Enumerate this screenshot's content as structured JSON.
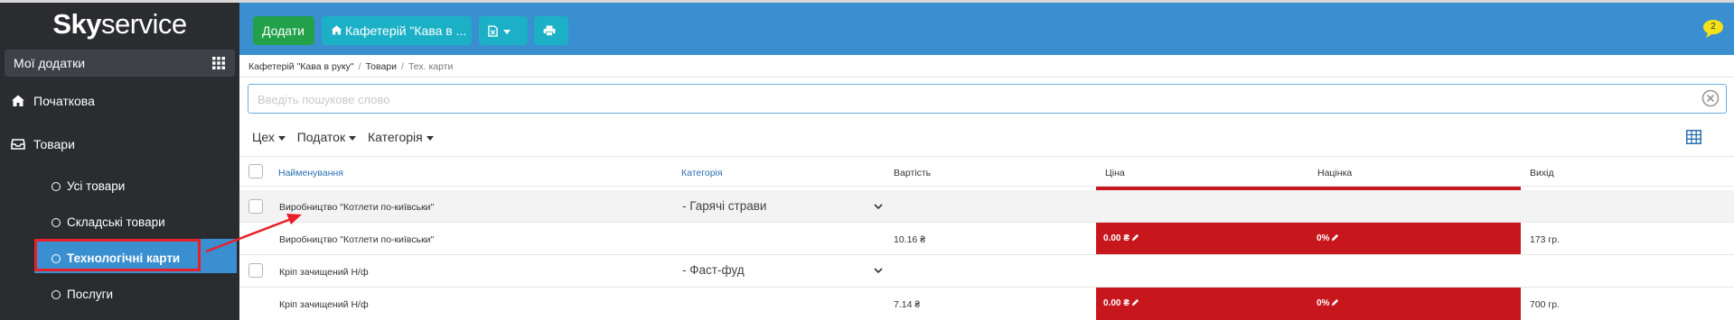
{
  "sidebar": {
    "logo_bold": "Sky",
    "logo_light": "service",
    "my_apps": "Мої додатки",
    "nav": [
      {
        "label": "Початкова",
        "icon": "home-icon"
      },
      {
        "label": "Товари",
        "icon": "inbox-icon"
      }
    ],
    "sub_items": [
      {
        "label": "Усі товари"
      },
      {
        "label": "Складські товари"
      },
      {
        "label": "Технологічні карти",
        "active": true
      },
      {
        "label": "Послуги"
      }
    ]
  },
  "toolbar": {
    "add_label": "Додати",
    "store_label": "Кафетерій \"Кава в ...",
    "notification_count": "2"
  },
  "breadcrumb": [
    "Кафетерій \"Кава в руку\"",
    "Товари",
    "Тех. карти"
  ],
  "search": {
    "placeholder": "Введіть пошукове слово",
    "value": ""
  },
  "filters": [
    "Цех",
    "Податок",
    "Категорія"
  ],
  "table": {
    "headers": [
      "Найменування",
      "Категорія",
      "Вартість",
      "Ціна",
      "Націнка",
      "Вихід"
    ],
    "groups": [
      {
        "name": "Виробництво \"Котлети по-київськи\"",
        "category": "- Гарячі страви",
        "item": {
          "name": "Виробництво \"Котлети по-київськи\"",
          "cost": "10.16 ₴",
          "price": "0.00 ₴",
          "markup": "0%",
          "yield": "173 гр."
        }
      },
      {
        "name": "Кріп зачищений Н/ф",
        "category": "- Фаст-фуд",
        "item": {
          "name": "Кріп зачищений Н/ф",
          "cost": "7.14 ₴",
          "price": "0.00 ₴",
          "markup": "0%",
          "yield": "700 гр."
        }
      }
    ]
  },
  "colors": {
    "topbar": "#3a8fd0",
    "sidebar": "#2a2c30",
    "add_button": "#22a04a",
    "toolbar_button": "#1bb0c6",
    "price_highlight": "#c8161d",
    "annotation": "#e8202a"
  }
}
